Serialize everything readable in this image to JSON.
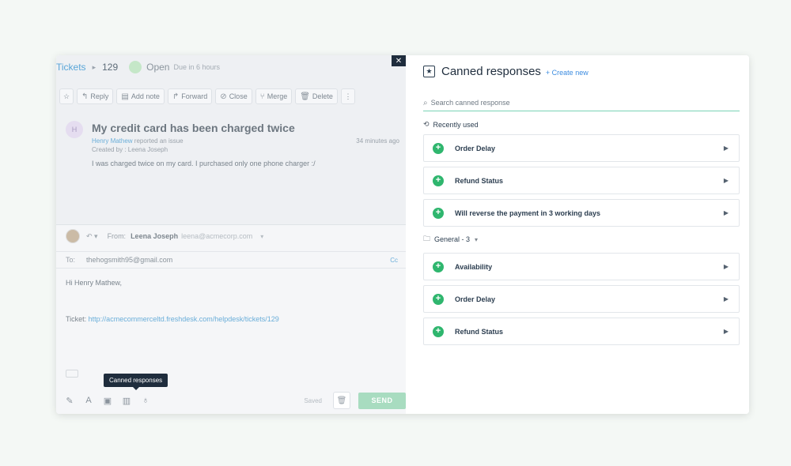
{
  "ticket": {
    "breadcrumb_root": "Tickets",
    "breadcrumb_sep": "▸",
    "number": "129",
    "status": "Open",
    "due": "Due in 6 hours"
  },
  "toolbar": {
    "star_icon": "☆",
    "reply": "Reply",
    "add_note": "Add note",
    "forward": "Forward",
    "close": "Close",
    "merge": "Merge",
    "delete": "Delete",
    "more_icon": "⋮"
  },
  "message": {
    "avatar_initial": "H",
    "subject": "My credit card has been charged twice",
    "reporter_name": "Henry Mathew",
    "reporter_suffix": " reported an issue",
    "created_by": "Created by : Leena Joseph",
    "time_ago": "34 minutes ago",
    "body": "I was charged twice on my card. I purchased only one phone charger :/"
  },
  "reply": {
    "from_label": "From:",
    "agent_name": "Leena Joseph",
    "agent_email": "leena@acmecorp.com",
    "to_label": "To:",
    "to_address": "thehogsmith95@gmail.com",
    "cc_label": "Cc",
    "greeting": "Hi Henry Mathew,",
    "ticket_label": "Ticket: ",
    "ticket_link": "http://acmecommerceltd.freshdesk.com/helpdesk/tickets/129",
    "tooltip": "Canned responses",
    "saved": "Saved",
    "send": "SEND"
  },
  "canned": {
    "close_icon": "✕",
    "title": "Canned responses",
    "create_new": "+ Create new",
    "search_placeholder": "Search canned response",
    "recent_label": "Recently used",
    "recent": [
      {
        "label": "Order Delay"
      },
      {
        "label": "Refund Status"
      },
      {
        "label": "Will reverse the payment in 3 working days"
      }
    ],
    "folder_label": "General - 3",
    "folder_items": [
      {
        "label": "Availability"
      },
      {
        "label": "Order Delay"
      },
      {
        "label": "Refund Status"
      }
    ]
  },
  "colors": {
    "accent_green": "#2fb66e",
    "link_blue": "#3c8ce0",
    "send_green": "#a8dcc0",
    "tooltip_dark": "#1f2d3d"
  }
}
